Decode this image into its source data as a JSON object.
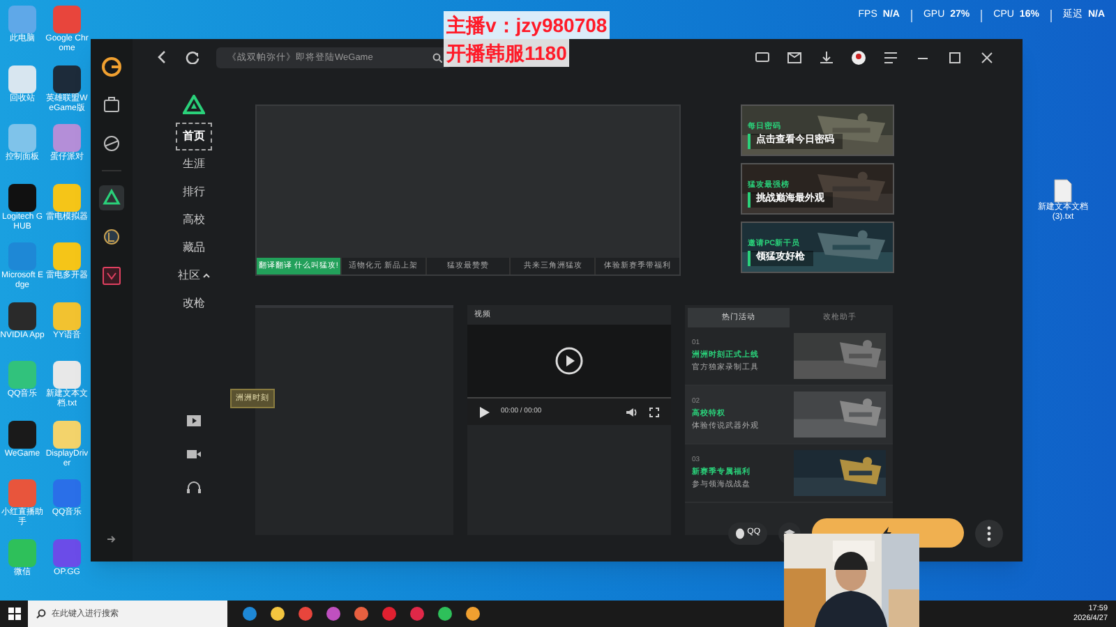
{
  "overlay_stats": [
    {
      "label": "FPS",
      "value": "N/A"
    },
    {
      "label": "GPU",
      "value": "27%"
    },
    {
      "label": "CPU",
      "value": "16%"
    },
    {
      "label": "延迟",
      "value": "N/A"
    }
  ],
  "stream_caption": [
    "主播v：jzy980708",
    "开播韩服1180"
  ],
  "desktop_icons": [
    {
      "label": "此电脑",
      "color": "#5fa8e8"
    },
    {
      "label": "Google Chrome",
      "color": "#e8453c"
    },
    {
      "label": "回收站",
      "color": "#d8e6f0"
    },
    {
      "label": "英雄联盟WeGame版",
      "color": "#1d2b3a"
    },
    {
      "label": "控制面板",
      "color": "#7fc3ea"
    },
    {
      "label": "蛋仔派对",
      "color": "#b48ed8"
    },
    {
      "label": "Logitech G HUB",
      "color": "#111111"
    },
    {
      "label": "雷电模拟器",
      "color": "#f5c518"
    },
    {
      "label": "Microsoft Edge",
      "color": "#1e88d6"
    },
    {
      "label": "雷电多开器",
      "color": "#f5c518"
    },
    {
      "label": "NVIDIA App",
      "color": "#2a2a2a"
    },
    {
      "label": "YY语音",
      "color": "#f2c230"
    },
    {
      "label": "QQ音乐",
      "color": "#31c27c"
    },
    {
      "label": "新建文本文档.txt",
      "color": "#e8e8e8"
    },
    {
      "label": "WeGame",
      "color": "#1a1a1a"
    },
    {
      "label": "DisplayDriver",
      "color": "#f3d36b"
    },
    {
      "label": "小红直播助手",
      "color": "#e8553c"
    },
    {
      "label": "QQ音乐",
      "color": "#2a6fe8"
    },
    {
      "label": "微信",
      "color": "#2ec05a"
    },
    {
      "label": "OP.GG",
      "color": "#6b4ce8"
    }
  ],
  "right_desktop_icons": [
    {
      "label": "新建文本文档 (3).txt"
    }
  ],
  "app": {
    "search": {
      "placeholder": "《战双帕弥什》即将登陆WeGame"
    },
    "rail": [
      {
        "kind": "bag",
        "selected": false
      },
      {
        "kind": "planet",
        "selected": false
      },
      {
        "kind": "delta",
        "selected": true
      },
      {
        "kind": "league",
        "selected": false
      },
      {
        "kind": "valorant",
        "selected": false
      }
    ],
    "nav": [
      {
        "label": "首页",
        "selected": true
      },
      {
        "label": "生涯",
        "selected": false
      },
      {
        "label": "排行",
        "selected": false
      },
      {
        "label": "高校",
        "selected": false
      },
      {
        "label": "藏品",
        "selected": false
      },
      {
        "label": "社区",
        "selected": false,
        "expandable": true
      },
      {
        "label": "改枪",
        "selected": false
      }
    ],
    "banner_tabs": [
      {
        "label": "翻译翻译 什么叫猛攻!",
        "selected": true
      },
      {
        "label": "适物化元 新品上架",
        "selected": false
      },
      {
        "label": "猛攻最赞赞",
        "selected": false
      },
      {
        "label": "共来三角洲猛攻",
        "selected": false
      },
      {
        "label": "体验新赛季带福利",
        "selected": false
      }
    ],
    "promos": [
      {
        "tag": "每日密码",
        "title": "点击查看今日密码"
      },
      {
        "tag": "猛攻最强榜",
        "title": "挑战巅海最外观"
      },
      {
        "tag": "邀请PC新干员",
        "title": "领猛攻好枪"
      }
    ],
    "video": {
      "title": "视频",
      "time": "00:00 / 00:00"
    },
    "activity_tabs": [
      {
        "label": "热门活动",
        "selected": true
      },
      {
        "label": "改枪助手",
        "selected": false
      }
    ],
    "activities": [
      {
        "index": "01",
        "title": "洲洲时刻正式上线",
        "desc": "官方独家录制工具"
      },
      {
        "index": "02",
        "title": "高校特权",
        "desc": "体验传说武器外观"
      },
      {
        "index": "03",
        "title": "新赛季专属福利",
        "desc": "参与领海战战盘"
      }
    ],
    "tooltip": "洲洲时刻",
    "qq_label": "QQ"
  },
  "taskbar": {
    "search_placeholder": "在此键入进行搜索",
    "time": "17:59",
    "date": "2026/4/27"
  }
}
